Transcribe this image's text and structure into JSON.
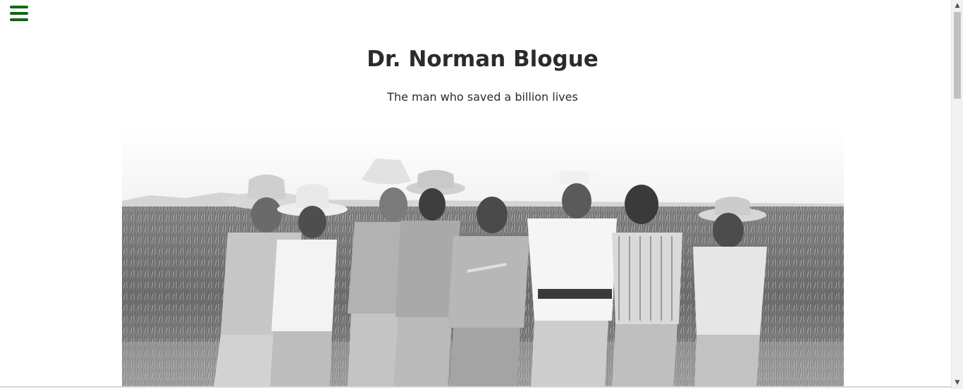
{
  "header": {
    "title": "Dr. Norman Blogue",
    "subtitle": "The man who saved a billion lives"
  },
  "menu": {
    "icon": "hamburger-menu-icon",
    "color": "#0a6b12"
  },
  "hero": {
    "icon": "black-and-white-photo"
  },
  "scrollbar": {
    "up_arrow": "▲",
    "down_arrow": "▼"
  }
}
